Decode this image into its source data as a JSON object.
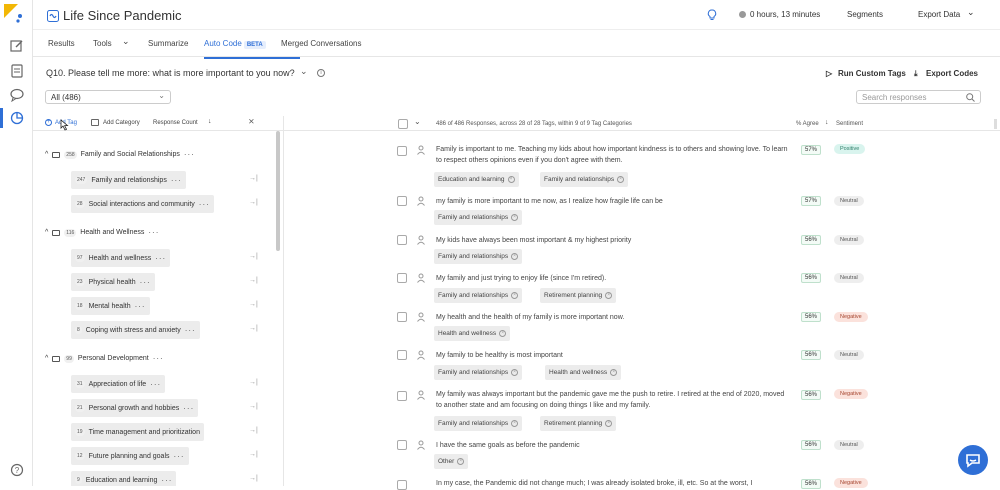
{
  "app": {
    "title": "Life Since Pandemic"
  },
  "header": {
    "timer": "0 hours, 13 minutes",
    "segments": "Segments",
    "export_data": "Export Data"
  },
  "tabs": [
    {
      "label": "Results"
    },
    {
      "label": "Tools"
    },
    {
      "label": "Summarize"
    },
    {
      "label": "Auto Code",
      "badge": "BETA",
      "active": true
    },
    {
      "label": "Merged Conversations"
    }
  ],
  "question": {
    "text": "Q10.  Please tell me more: what is more important to you now?",
    "run_custom_tags": "Run Custom Tags",
    "export_codes": "Export Codes"
  },
  "filter": {
    "selected": "All (486)"
  },
  "search": {
    "placeholder": "Search responses"
  },
  "left_header": {
    "add_tag": "Add Tag",
    "add_category": "Add Category",
    "sort": "Response Count"
  },
  "categories": [
    {
      "count": "258",
      "name": "Family and Social Relationships",
      "tags": [
        {
          "count": "247",
          "name": "Family and relationships"
        },
        {
          "count": "28",
          "name": "Social interactions and community"
        }
      ]
    },
    {
      "count": "116",
      "name": "Health and Wellness",
      "tags": [
        {
          "count": "97",
          "name": "Health and wellness"
        },
        {
          "count": "23",
          "name": "Physical health"
        },
        {
          "count": "18",
          "name": "Mental health"
        },
        {
          "count": "8",
          "name": "Coping with stress and anxiety"
        }
      ]
    },
    {
      "count": "99",
      "name": "Personal Development",
      "tags": [
        {
          "count": "31",
          "name": "Appreciation of life"
        },
        {
          "count": "21",
          "name": "Personal growth and hobbies"
        },
        {
          "count": "19",
          "name": "Time management and prioritization"
        },
        {
          "count": "12",
          "name": "Future planning and goals"
        },
        {
          "count": "9",
          "name": "Education and learning"
        }
      ]
    }
  ],
  "right_header": {
    "summary": "486 of 486 Responses, across 28 of 28 Tags, within 9 of 9 Tag Categories",
    "agree": "% Agree",
    "sentiment": "Sentiment"
  },
  "responses": [
    {
      "text": "Family is important to me. Teaching my kids about how important kindness is to others and showing love. To learn to respect others opinions even if you don't agree with them.",
      "tags": [
        "Education and learning",
        "Family and relationships"
      ],
      "agree": "57%",
      "sentiment": "Positive"
    },
    {
      "text": "my family is more important to me now, as I realize how fragile life can be",
      "tags": [
        "Family and relationships"
      ],
      "agree": "57%",
      "sentiment": "Neutral"
    },
    {
      "text": "My kids have always been most important & my highest priority",
      "tags": [
        "Family and relationships"
      ],
      "agree": "56%",
      "sentiment": "Neutral"
    },
    {
      "text": "My family and just trying to enjoy life (since I'm retired).",
      "tags": [
        "Family and relationships",
        "Retirement planning"
      ],
      "agree": "56%",
      "sentiment": "Neutral"
    },
    {
      "text": "My health and the health of my family is more important now.",
      "tags": [
        "Health and wellness"
      ],
      "agree": "56%",
      "sentiment": "Negative"
    },
    {
      "text": "My family to be healthy is most important",
      "tags": [
        "Family and relationships",
        "Health and wellness"
      ],
      "agree": "56%",
      "sentiment": "Neutral"
    },
    {
      "text": "My family was always important but the pandemic gave me the push to retire. I retired at the end of 2020, moved to another state and am focusing on doing things I like and my family.",
      "tags": [
        "Family and relationships",
        "Retirement planning"
      ],
      "agree": "56%",
      "sentiment": "Negative"
    },
    {
      "text": "I have the same goals as before the pandemic",
      "tags": [
        "Other"
      ],
      "agree": "56%",
      "sentiment": "Neutral"
    },
    {
      "text": "In my case, the Pandemic did not change much; I was already isolated broke, ill, etc. So at the worst, I",
      "tags": [],
      "agree": "56%",
      "sentiment": "Negative"
    }
  ]
}
